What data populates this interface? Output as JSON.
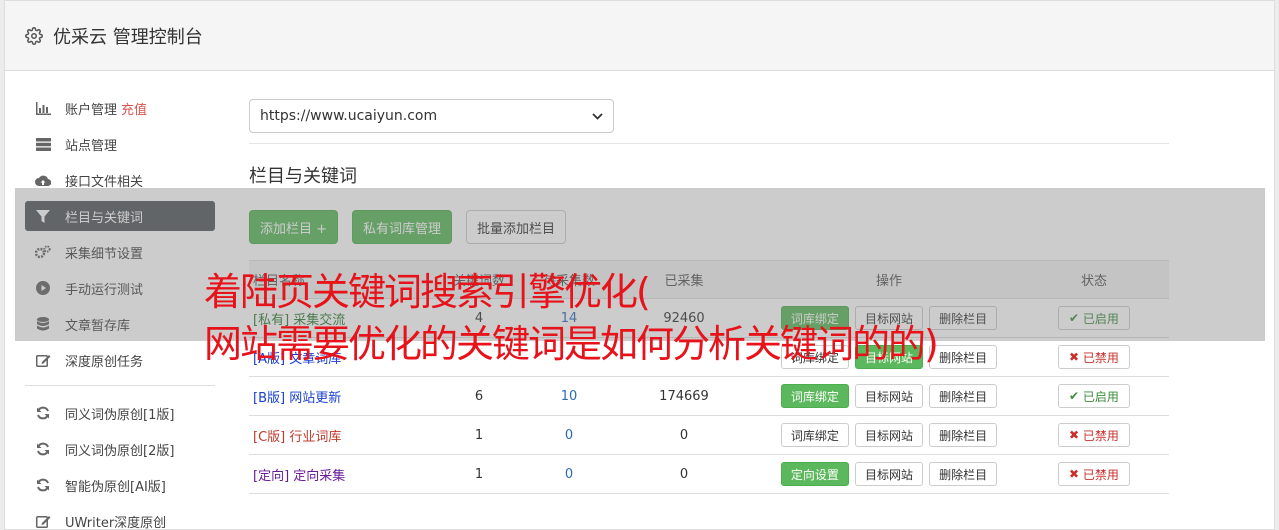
{
  "header": {
    "title": "优采云 管理控制台",
    "icon": "gear-icon"
  },
  "sidebar": {
    "items": [
      {
        "label": "账户管理",
        "extra": "充值",
        "icon": "bar-chart-icon"
      },
      {
        "label": "站点管理",
        "icon": "server-icon"
      },
      {
        "label": "接口文件相关",
        "icon": "cloud-upload-icon"
      },
      {
        "label": "栏目与关键词",
        "icon": "filter-icon",
        "active": true
      },
      {
        "label": "采集细节设置",
        "icon": "gears-icon"
      },
      {
        "label": "手动运行测试",
        "icon": "play-circle-icon"
      },
      {
        "label": "文章暂存库",
        "icon": "database-icon"
      },
      {
        "label": "深度原创任务",
        "icon": "edit-icon"
      },
      {
        "label": "同义词伪原创[1版]",
        "icon": "refresh-icon"
      },
      {
        "label": "同义词伪原创[2版]",
        "icon": "refresh-icon"
      },
      {
        "label": "智能伪原创[AI版]",
        "icon": "refresh-icon"
      },
      {
        "label": "UWriter深度原创",
        "icon": "edit-icon"
      }
    ]
  },
  "site_select": {
    "value": "https://www.ucaiyun.com"
  },
  "section_title": "栏目与关键词",
  "buttons": {
    "add_column": "添加栏目 +",
    "private_lib": "私有词库管理",
    "batch_add": "批量添加栏目"
  },
  "table": {
    "headers": [
      "栏目名称",
      "关键词数",
      "待采集数",
      "已采集",
      "操作",
      "状态"
    ],
    "rows": [
      {
        "tag": "[私有]",
        "name": "采集交流",
        "kw": "4",
        "pending": "14",
        "done": "92460",
        "bind": "词库绑定",
        "bind_green": true,
        "target": "目标网站",
        "del": "删除栏目",
        "status": "已启用",
        "on": true,
        "color": "green"
      },
      {
        "tag": "[A版]",
        "name": "文章词库",
        "kw": "",
        "pending": "",
        "done": "",
        "bind": "词库绑定",
        "bind_green": false,
        "target": "目标网站",
        "del": "删除栏目",
        "status": "已禁用",
        "on": false,
        "color": "blue"
      },
      {
        "tag": "[B版]",
        "name": "网站更新",
        "kw": "6",
        "pending": "10",
        "done": "174669",
        "bind": "词库绑定",
        "bind_green": true,
        "target": "目标网站",
        "del": "删除栏目",
        "status": "已启用",
        "on": true,
        "color": "blue"
      },
      {
        "tag": "[C版]",
        "name": "行业词库",
        "kw": "1",
        "pending": "0",
        "done": "0",
        "bind": "词库绑定",
        "bind_green": false,
        "target": "目标网站",
        "del": "删除栏目",
        "status": "已禁用",
        "on": false,
        "color": "red"
      },
      {
        "tag": "[定向]",
        "name": "定向采集",
        "kw": "1",
        "pending": "0",
        "done": "0",
        "bind": "定向设置",
        "bind_green": true,
        "target": "目标网站",
        "del": "删除栏目",
        "status": "已禁用",
        "on": false,
        "color": "purple"
      }
    ]
  },
  "overlay": {
    "line1": "着陆页关键词搜索引擎优化(",
    "line2": "网站需要优化的关键词是如何分析关键词的的)"
  },
  "colors": {
    "accent_green": "#5cb85c",
    "active_nav": "#55595c",
    "overlay_text": "#e8121a",
    "recharge": "#d9534f"
  }
}
